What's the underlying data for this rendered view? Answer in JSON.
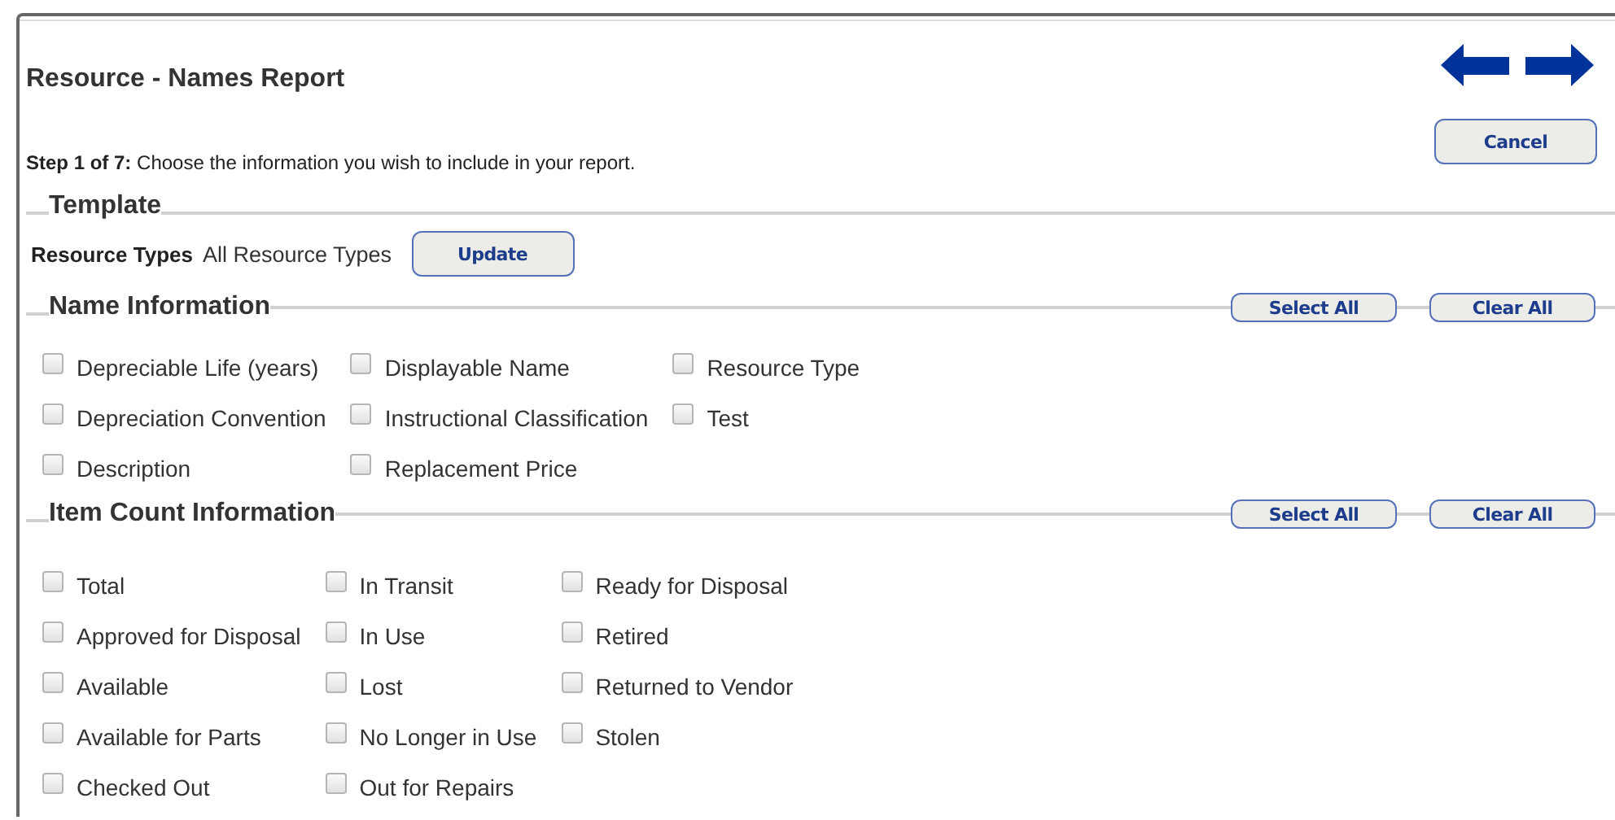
{
  "window": {
    "title": "Resource - Names Report"
  },
  "cancel_button": "Cancel",
  "step": "**Step 1 of 7:** Choose the information you wish to include in your report.",
  "template": {
    "title": "Template",
    "field_label": "Resource Types",
    "field_value": "All Resource Types",
    "button": "Update"
  },
  "sections": [
    {
      "title": "Name Information",
      "buttons": [
        "Select All",
        "Clear All"
      ],
      "items": [
        {
          "label": "Depreciable Life (years)",
          "checked": false
        },
        {
          "label": "Displayable Name",
          "checked": false
        },
        {
          "label": "Resource Type",
          "checked": false
        },
        {
          "label": "Depreciation Convention",
          "checked": false
        },
        {
          "label": "Instructional Classification",
          "checked": false
        },
        {
          "label": "Test",
          "checked": false
        },
        {
          "label": "Description",
          "checked": false
        },
        {
          "label": "Replacement Price",
          "checked": false
        }
      ]
    },
    {
      "title": "Item Count Information",
      "buttons": [
        "Select All",
        "Clear All"
      ],
      "items": [
        {
          "label": "Total",
          "checked": false
        },
        {
          "label": "In Transit",
          "checked": false
        },
        {
          "label": "Ready for Disposal",
          "checked": false
        },
        {
          "label": "Approved for Disposal",
          "checked": false
        },
        {
          "label": "In Use",
          "checked": false
        },
        {
          "label": "Retired",
          "checked": false
        },
        {
          "label": "Available",
          "checked": false
        },
        {
          "label": "Lost",
          "checked": false
        },
        {
          "label": "Returned to Vendor",
          "checked": false
        },
        {
          "label": "Available for Parts",
          "checked": false
        },
        {
          "label": "No Longer in Use",
          "checked": false
        },
        {
          "label": "Stolen",
          "checked": false
        },
        {
          "label": "Checked Out",
          "checked": false
        },
        {
          "label": "Out for Repairs",
          "checked": false
        }
      ]
    }
  ]
}
